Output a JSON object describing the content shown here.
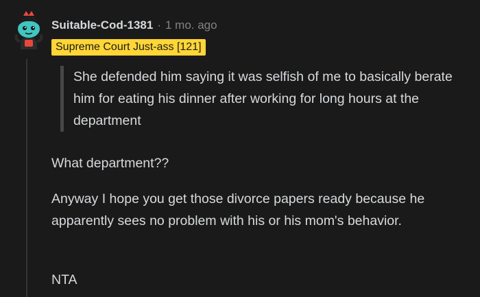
{
  "comment": {
    "username": "Suitable-Cod-1381",
    "separator": "·",
    "timestamp": "1 mo. ago",
    "flair": "Supreme Court Just-ass [121]",
    "quote": "She defended him saying it was selfish of me to basically berate him for eating his dinner after working for long hours at the department",
    "paragraphs": [
      "What department??",
      "Anyway I hope you get those divorce papers ready because he apparently sees no problem with his or his mom's behavior.",
      "NTA"
    ]
  },
  "colors": {
    "background": "#1a1a1b",
    "text": "#d7dadc",
    "muted": "#818384",
    "flair_bg": "#ffd635",
    "avatar_teal": "#3fc6c0",
    "avatar_accent": "#e8483b"
  },
  "icons": {
    "avatar": "snoo-avatar-icon"
  }
}
